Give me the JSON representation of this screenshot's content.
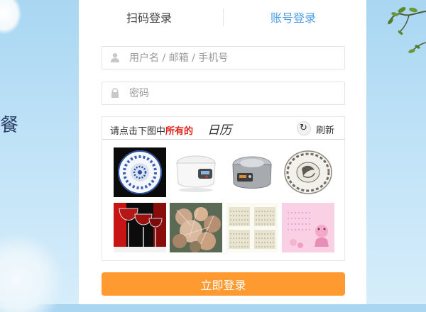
{
  "background": {
    "left_partial_char": "餐",
    "accent_color": "#a9d6f2"
  },
  "tabs": {
    "scan_login": "扫码登录",
    "account_login": "账号登录",
    "active_color": "#4f9fe8"
  },
  "form": {
    "username": {
      "placeholder": "用户名 / 邮箱 / 手机号",
      "value": "",
      "icon": "user-icon"
    },
    "password": {
      "placeholder": "密码",
      "value": "",
      "icon": "lock-icon"
    }
  },
  "captcha": {
    "instruction_prefix": "请点击下图中",
    "instruction_highlight": "所有的",
    "target_word": "日历",
    "refresh_label": "刷新",
    "highlight_color": "#e2231a",
    "images": [
      {
        "subject": "blue-white-porcelain-plate"
      },
      {
        "subject": "rice-cooker-white"
      },
      {
        "subject": "rice-cooker-steel"
      },
      {
        "subject": "decorative-plate"
      },
      {
        "subject": "wine-glasses"
      },
      {
        "subject": "coral-plant"
      },
      {
        "subject": "calendar"
      },
      {
        "subject": "calendar-pink"
      }
    ]
  },
  "submit": {
    "label": "立即登录",
    "color": "#ff9a30"
  }
}
